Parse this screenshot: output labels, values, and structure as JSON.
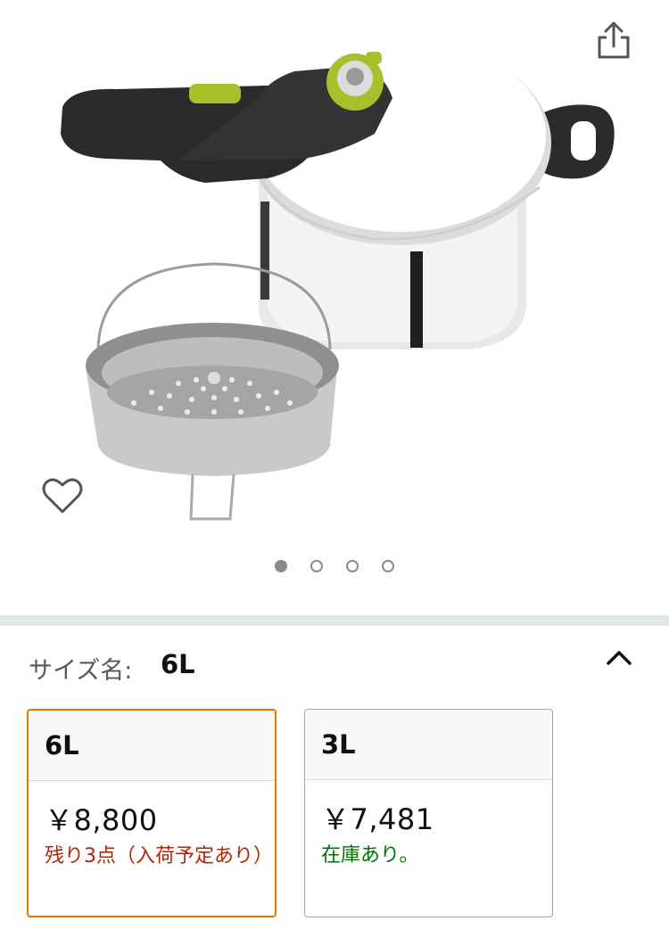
{
  "product_image": {
    "slide_count": 4,
    "active_slide": 1
  },
  "icons": {
    "share": "share-icon",
    "favorite": "heart-icon",
    "collapse": "chevron-up-icon"
  },
  "size_selector": {
    "label": "サイズ名:",
    "selected_value": "6L",
    "options": [
      {
        "name": "6L",
        "price": "￥8,800",
        "availability": "残り3点（入荷予定あり）",
        "selected": true
      },
      {
        "name": "3L",
        "price": "￥7,481",
        "availability": "在庫あり。",
        "selected": false
      }
    ]
  },
  "colors": {
    "selected_border": "#e77600",
    "low_stock": "#b12704",
    "in_stock": "#007600",
    "divider": "#e3e6e6"
  }
}
